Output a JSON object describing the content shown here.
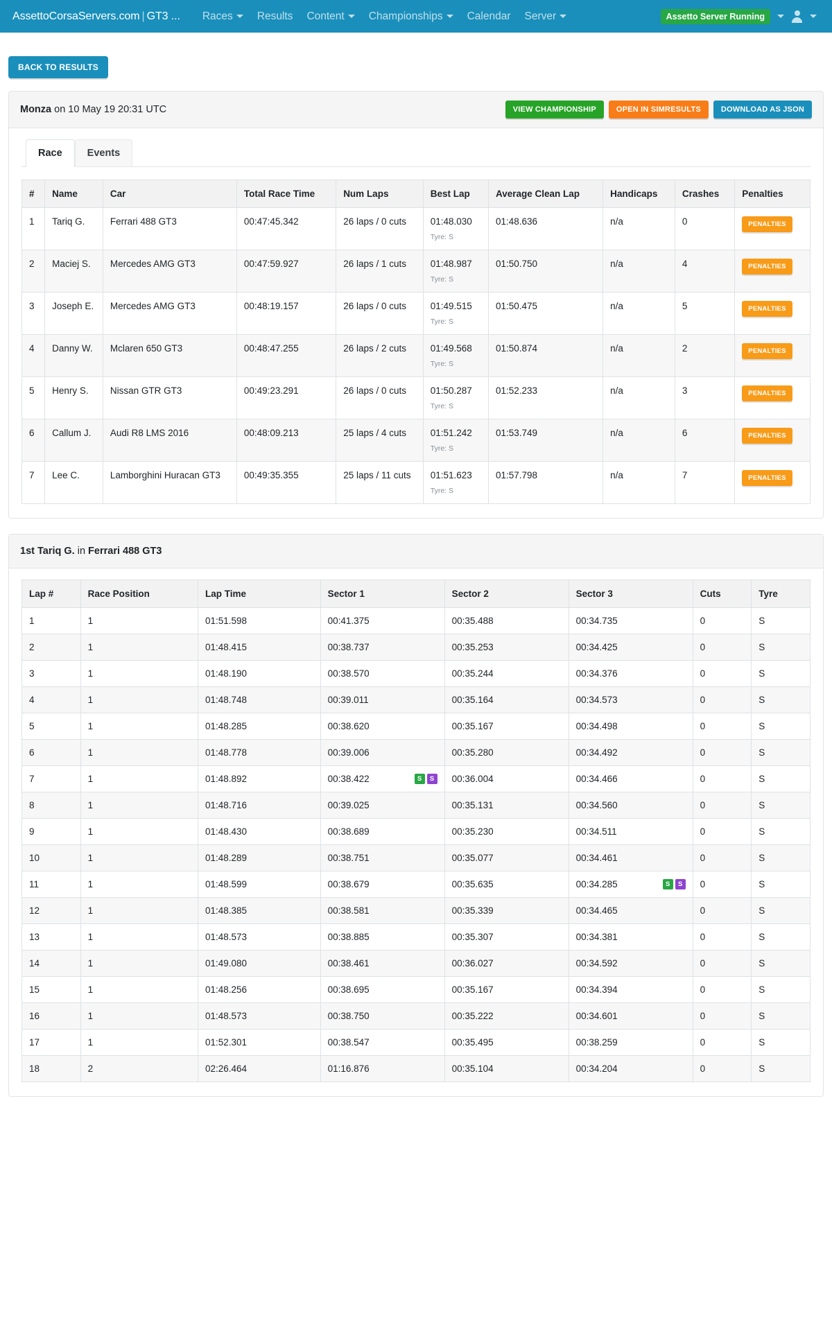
{
  "navbar": {
    "brand_main": "AssettoCorsaServers.com",
    "brand_sep": "|",
    "brand_sub": "GT3 ...",
    "links": [
      {
        "label": "Races",
        "caret": true
      },
      {
        "label": "Results",
        "caret": false
      },
      {
        "label": "Content",
        "caret": true
      },
      {
        "label": "Championships",
        "caret": true
      },
      {
        "label": "Calendar",
        "caret": false
      },
      {
        "label": "Server",
        "caret": true
      }
    ],
    "server_status": "Assetto Server Running",
    "user_icon": "user-icon",
    "caret_icon": "chevron-down-icon",
    "accent_color": "#1a8fbb",
    "status_color": "#28a745"
  },
  "page": {
    "back_button": "BACK TO RESULTS"
  },
  "race_card": {
    "title_track": "Monza",
    "title_rest": " on 10 May 19 20:31 UTC",
    "buttons": {
      "view_championship": "VIEW CHAMPIONSHIP",
      "open_in_simresults": "OPEN IN SIMRESULTS",
      "download_as_json": "DOWNLOAD AS JSON"
    },
    "tabs": [
      {
        "label": "Race",
        "active": true
      },
      {
        "label": "Events",
        "active": false
      }
    ],
    "table_headers": [
      "#",
      "Name",
      "Car",
      "Total Race Time",
      "Num Laps",
      "Best Lap",
      "Average Clean Lap",
      "Handicaps",
      "Crashes",
      "Penalties"
    ],
    "penalties_label": "PENALTIES",
    "tyre_prefix": "Tyre: ",
    "rows": [
      {
        "pos": "1",
        "name": "Tariq G.",
        "car": "Ferrari 488 GT3",
        "total_time": "00:47:45.342",
        "laps": "26 laps / 0 cuts",
        "best_lap": "01:48.030",
        "tyre": "S",
        "avg_clean": "01:48.636",
        "handicaps": "n/a",
        "crashes": "0"
      },
      {
        "pos": "2",
        "name": "Maciej S.",
        "car": "Mercedes AMG GT3",
        "total_time": "00:47:59.927",
        "laps": "26 laps / 1 cuts",
        "best_lap": "01:48.987",
        "tyre": "S",
        "avg_clean": "01:50.750",
        "handicaps": "n/a",
        "crashes": "4"
      },
      {
        "pos": "3",
        "name": "Joseph E.",
        "car": "Mercedes AMG GT3",
        "total_time": "00:48:19.157",
        "laps": "26 laps / 0 cuts",
        "best_lap": "01:49.515",
        "tyre": "S",
        "avg_clean": "01:50.475",
        "handicaps": "n/a",
        "crashes": "5"
      },
      {
        "pos": "4",
        "name": "Danny W.",
        "car": "Mclaren 650 GT3",
        "total_time": "00:48:47.255",
        "laps": "26 laps / 2 cuts",
        "best_lap": "01:49.568",
        "tyre": "S",
        "avg_clean": "01:50.874",
        "handicaps": "n/a",
        "crashes": "2"
      },
      {
        "pos": "5",
        "name": "Henry S.",
        "car": "Nissan GTR GT3",
        "total_time": "00:49:23.291",
        "laps": "26 laps / 0 cuts",
        "best_lap": "01:50.287",
        "tyre": "S",
        "avg_clean": "01:52.233",
        "handicaps": "n/a",
        "crashes": "3"
      },
      {
        "pos": "6",
        "name": "Callum J.",
        "car": "Audi R8 LMS 2016",
        "total_time": "00:48:09.213",
        "laps": "25 laps / 4 cuts",
        "best_lap": "01:51.242",
        "tyre": "S",
        "avg_clean": "01:53.749",
        "handicaps": "n/a",
        "crashes": "6"
      },
      {
        "pos": "7",
        "name": "Lee C.",
        "car": "Lamborghini Huracan GT3",
        "total_time": "00:49:35.355",
        "laps": "25 laps / 11 cuts",
        "best_lap": "01:51.623",
        "tyre": "S",
        "avg_clean": "01:57.798",
        "handicaps": "n/a",
        "crashes": "7"
      }
    ]
  },
  "driver_card": {
    "title_pos": "1st Tariq G.",
    "title_mid": " in ",
    "title_car": "Ferrari 488 GT3",
    "table_headers": [
      "Lap #",
      "Race Position",
      "Lap Time",
      "Sector 1",
      "Sector 2",
      "Sector 3",
      "Cuts",
      "Tyre"
    ],
    "badge_label": "S",
    "laps": [
      {
        "lap": "1",
        "pos": "1",
        "time": "01:51.598",
        "s1": "00:41.375",
        "s1b": [],
        "s2": "00:35.488",
        "s2b": [],
        "s3": "00:34.735",
        "s3b": [],
        "cuts": "0",
        "tyre": "S"
      },
      {
        "lap": "2",
        "pos": "1",
        "time": "01:48.415",
        "s1": "00:38.737",
        "s1b": [],
        "s2": "00:35.253",
        "s2b": [],
        "s3": "00:34.425",
        "s3b": [],
        "cuts": "0",
        "tyre": "S"
      },
      {
        "lap": "3",
        "pos": "1",
        "time": "01:48.190",
        "s1": "00:38.570",
        "s1b": [],
        "s2": "00:35.244",
        "s2b": [],
        "s3": "00:34.376",
        "s3b": [],
        "cuts": "0",
        "tyre": "S"
      },
      {
        "lap": "4",
        "pos": "1",
        "time": "01:48.748",
        "s1": "00:39.011",
        "s1b": [],
        "s2": "00:35.164",
        "s2b": [],
        "s3": "00:34.573",
        "s3b": [],
        "cuts": "0",
        "tyre": "S"
      },
      {
        "lap": "5",
        "pos": "1",
        "time": "01:48.285",
        "s1": "00:38.620",
        "s1b": [],
        "s2": "00:35.167",
        "s2b": [],
        "s3": "00:34.498",
        "s3b": [],
        "cuts": "0",
        "tyre": "S"
      },
      {
        "lap": "6",
        "pos": "1",
        "time": "01:48.778",
        "s1": "00:39.006",
        "s1b": [],
        "s2": "00:35.280",
        "s2b": [],
        "s3": "00:34.492",
        "s3b": [],
        "cuts": "0",
        "tyre": "S"
      },
      {
        "lap": "7",
        "pos": "1",
        "time": "01:48.892",
        "s1": "00:38.422",
        "s1b": [
          "green",
          "purple"
        ],
        "s2": "00:36.004",
        "s2b": [],
        "s3": "00:34.466",
        "s3b": [],
        "cuts": "0",
        "tyre": "S"
      },
      {
        "lap": "8",
        "pos": "1",
        "time": "01:48.716",
        "s1": "00:39.025",
        "s1b": [],
        "s2": "00:35.131",
        "s2b": [],
        "s3": "00:34.560",
        "s3b": [],
        "cuts": "0",
        "tyre": "S"
      },
      {
        "lap": "9",
        "pos": "1",
        "time": "01:48.430",
        "s1": "00:38.689",
        "s1b": [],
        "s2": "00:35.230",
        "s2b": [],
        "s3": "00:34.511",
        "s3b": [],
        "cuts": "0",
        "tyre": "S"
      },
      {
        "lap": "10",
        "pos": "1",
        "time": "01:48.289",
        "s1": "00:38.751",
        "s1b": [],
        "s2": "00:35.077",
        "s2b": [],
        "s3": "00:34.461",
        "s3b": [],
        "cuts": "0",
        "tyre": "S"
      },
      {
        "lap": "11",
        "pos": "1",
        "time": "01:48.599",
        "s1": "00:38.679",
        "s1b": [],
        "s2": "00:35.635",
        "s2b": [],
        "s3": "00:34.285",
        "s3b": [
          "green",
          "purple"
        ],
        "cuts": "0",
        "tyre": "S"
      },
      {
        "lap": "12",
        "pos": "1",
        "time": "01:48.385",
        "s1": "00:38.581",
        "s1b": [],
        "s2": "00:35.339",
        "s2b": [],
        "s3": "00:34.465",
        "s3b": [],
        "cuts": "0",
        "tyre": "S"
      },
      {
        "lap": "13",
        "pos": "1",
        "time": "01:48.573",
        "s1": "00:38.885",
        "s1b": [],
        "s2": "00:35.307",
        "s2b": [],
        "s3": "00:34.381",
        "s3b": [],
        "cuts": "0",
        "tyre": "S"
      },
      {
        "lap": "14",
        "pos": "1",
        "time": "01:49.080",
        "s1": "00:38.461",
        "s1b": [],
        "s2": "00:36.027",
        "s2b": [],
        "s3": "00:34.592",
        "s3b": [],
        "cuts": "0",
        "tyre": "S"
      },
      {
        "lap": "15",
        "pos": "1",
        "time": "01:48.256",
        "s1": "00:38.695",
        "s1b": [],
        "s2": "00:35.167",
        "s2b": [],
        "s3": "00:34.394",
        "s3b": [],
        "cuts": "0",
        "tyre": "S"
      },
      {
        "lap": "16",
        "pos": "1",
        "time": "01:48.573",
        "s1": "00:38.750",
        "s1b": [],
        "s2": "00:35.222",
        "s2b": [],
        "s3": "00:34.601",
        "s3b": [],
        "cuts": "0",
        "tyre": "S"
      },
      {
        "lap": "17",
        "pos": "1",
        "time": "01:52.301",
        "s1": "00:38.547",
        "s1b": [],
        "s2": "00:35.495",
        "s2b": [],
        "s3": "00:38.259",
        "s3b": [],
        "cuts": "0",
        "tyre": "S"
      },
      {
        "lap": "18",
        "pos": "2",
        "time": "02:26.464",
        "s1": "01:16.876",
        "s1b": [],
        "s2": "00:35.104",
        "s2b": [],
        "s3": "00:34.204",
        "s3b": [],
        "cuts": "0",
        "tyre": "S"
      }
    ]
  }
}
